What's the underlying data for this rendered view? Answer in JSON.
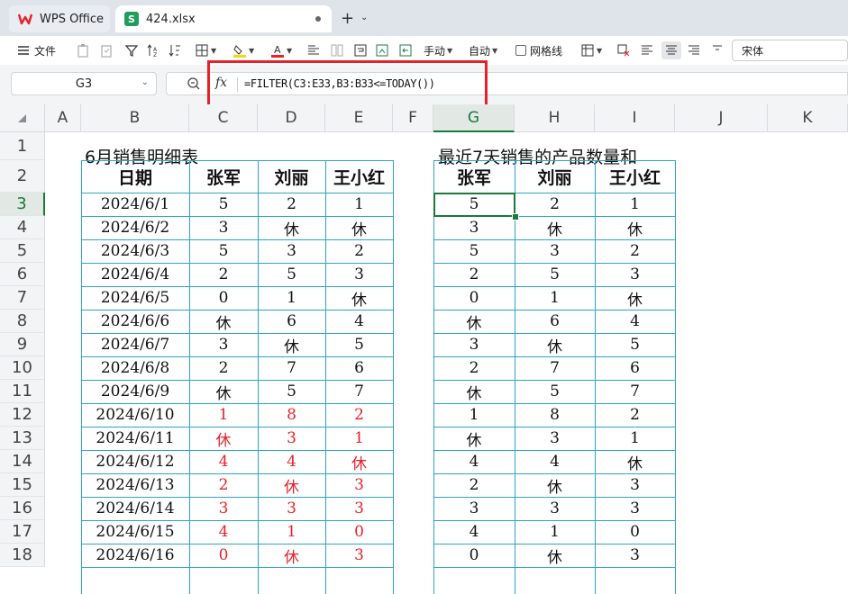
{
  "app": {
    "wps_tab_label": "WPS Office",
    "file_tab_label": "424.xlsx",
    "sheet_icon_letter": "S",
    "new_tab_symbol": "+",
    "brand_color": "#e6212a",
    "sheet_color": "#1e9e5a"
  },
  "toolbar": {
    "file_label": "文件",
    "wrap_label": "手动",
    "auto_label": "自动",
    "gridlines_label": "网格线",
    "font_name": "宋体"
  },
  "formula_bar": {
    "cell_ref": "G3",
    "fx_label": "fx",
    "formula": "=FILTER(C3:E33,B3:B33<=TODAY())"
  },
  "columns": [
    "A",
    "B",
    "C",
    "D",
    "E",
    "F",
    "G",
    "H",
    "I",
    "J",
    "K"
  ],
  "selected_column": "G",
  "rows": [
    "1",
    "2",
    "3",
    "4",
    "5",
    "6",
    "7",
    "8",
    "9",
    "10",
    "11",
    "12",
    "13",
    "14",
    "15",
    "16",
    "17",
    "18"
  ],
  "selected_row": "3",
  "left_table": {
    "title": "6月销售明细表",
    "headers": [
      "日期",
      "张军",
      "刘丽",
      "王小红"
    ],
    "rows": [
      [
        "2024/6/1",
        "5",
        "2",
        "1"
      ],
      [
        "2024/6/2",
        "3",
        "休",
        "休"
      ],
      [
        "2024/6/3",
        "5",
        "3",
        "2"
      ],
      [
        "2024/6/4",
        "2",
        "5",
        "3"
      ],
      [
        "2024/6/5",
        "0",
        "1",
        "休"
      ],
      [
        "2024/6/6",
        "休",
        "6",
        "4"
      ],
      [
        "2024/6/7",
        "3",
        "休",
        "5"
      ],
      [
        "2024/6/8",
        "2",
        "7",
        "6"
      ],
      [
        "2024/6/9",
        "休",
        "5",
        "7"
      ],
      [
        "2024/6/10",
        "1",
        "8",
        "2"
      ],
      [
        "2024/6/11",
        "休",
        "3",
        "1"
      ],
      [
        "2024/6/12",
        "4",
        "4",
        "休"
      ],
      [
        "2024/6/13",
        "2",
        "休",
        "3"
      ],
      [
        "2024/6/14",
        "3",
        "3",
        "3"
      ],
      [
        "2024/6/15",
        "4",
        "1",
        "0"
      ],
      [
        "2024/6/16",
        "0",
        "休",
        "3"
      ]
    ],
    "red_value_rows_from_index": 9,
    "value_highlight_color": "#e6212a"
  },
  "right_table": {
    "title": "最近7天销售的产品数量和",
    "headers": [
      "张军",
      "刘丽",
      "王小红"
    ],
    "rows": [
      [
        "5",
        "2",
        "1"
      ],
      [
        "3",
        "休",
        "休"
      ],
      [
        "5",
        "3",
        "2"
      ],
      [
        "2",
        "5",
        "3"
      ],
      [
        "0",
        "1",
        "休"
      ],
      [
        "休",
        "6",
        "4"
      ],
      [
        "3",
        "休",
        "5"
      ],
      [
        "2",
        "7",
        "6"
      ],
      [
        "休",
        "5",
        "7"
      ],
      [
        "1",
        "8",
        "2"
      ],
      [
        "休",
        "3",
        "1"
      ],
      [
        "4",
        "4",
        "休"
      ],
      [
        "2",
        "休",
        "3"
      ],
      [
        "3",
        "3",
        "3"
      ],
      [
        "4",
        "1",
        "0"
      ],
      [
        "0",
        "休",
        "3"
      ]
    ]
  }
}
